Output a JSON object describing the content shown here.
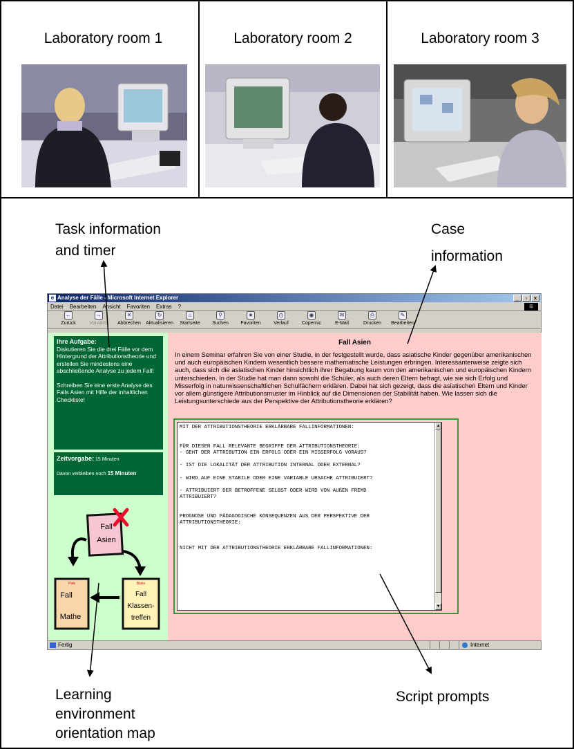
{
  "rooms": [
    {
      "label": "Laboratory room 1"
    },
    {
      "label": "Laboratory room 2"
    },
    {
      "label": "Laboratory room 3"
    }
  ],
  "callouts": {
    "task_info": [
      "Task information",
      "and timer"
    ],
    "case_info": [
      "Case",
      "information"
    ],
    "orientation_map": [
      "Learning",
      "environment",
      "orientation map"
    ],
    "script_prompts": "Script prompts"
  },
  "browser": {
    "title": "Analyse der Fälle - Microsoft Internet Explorer",
    "menu": [
      "Datei",
      "Bearbeiten",
      "Ansicht",
      "Favoriten",
      "Extras",
      "?"
    ],
    "toolbar": [
      "Zurück",
      "Vorwärts",
      "Abbrechen",
      "Aktualisieren",
      "Startseite",
      "Suchen",
      "Favoriten",
      "Verlauf",
      "Copernic",
      "E-Mail",
      "Drucken",
      "Bearbeiten"
    ],
    "status": "Fertig",
    "zone": "Internet"
  },
  "task": {
    "heading": "Ihre Aufgabe:",
    "text1": "Diskutieren Sie die drei Fälle vor dem Hintergrund der Attributionstheorie und erstellen Sie mindestens eine abschließende Analyse zu jedem Fall!",
    "text2": "Schreiben Sie eine erste Analyse des Falls Asien mit Hilfe der inhaltlichen Checkliste!"
  },
  "timer": {
    "label": "Zeitvorgabe:",
    "limit": "15 Minuten",
    "remaining_prefix": "Davon verbleiben noch",
    "remaining": "15 Minuten"
  },
  "map": {
    "asien": [
      "Fall",
      "Asien"
    ],
    "mathe": {
      "tag": "Pink",
      "lines": [
        "Fall",
        "Mathe"
      ]
    },
    "klassen": {
      "tag": "Blake",
      "lines": [
        "Fall",
        "Klassen-",
        "treffen"
      ]
    }
  },
  "case": {
    "title": "Fall Asien",
    "text": "In einem Seminar erfahren Sie von einer Studie, in der festgestellt wurde, dass asiatische Kinder gegenüber amerikanischen und auch europäischen Kindern wesentlich bessere mathematische Leistungen erbringen. Interessanterweise zeigte sich auch, dass sich die asiatischen Kinder hinsichtlich ihrer Begabung kaum von den amerikanischen und europäischen Kindern unterschieden. In der Studie hat man dann sowohl die Schüler, als auch deren Eltern befragt, wie sie sich Erfolg und Misserfolg in naturwissenschaftlichen Schulfächern erklären. Dabei hat sich gezeigt, dass die asiatischen Eltern und Kinder vor allem günstigere Attributionsmuster im Hinblick auf die Dimensionen der Stabilität haben. Wie lassen sich die Leistungsunterschiede aus der Perspektive der Attributionstheorie erklären?"
  },
  "script": {
    "lines": [
      "MIT DER ATTRIBUTIONSTHEORIE ERKLÄRBARE FALLINFORMATIONEN:",
      "",
      "",
      "FÜR DIESEN FALL RELEVANTE BEGRIFFE DER ATTRIBUTIONSTHEORIE:",
      "- GEHT DER ATTRIBUTION EIN ERFOLG ODER EIN MISSERFOLG VORAUS?",
      "",
      "- IST DIE LOKALITÄT DER ATTRIBUTION INTERNAL ODER EXTERNAL?",
      "",
      "- WIRD AUF EINE STABILE ODER EINE VARIABLE URSACHE ATTRIBUIERT?",
      "",
      "- ATTRIBUIERT DER BETROFFENE SELBST ODER WIRD VON AUßEN FREMD",
      "ATTRIBUIERT?",
      "",
      "",
      "PROGNOSE UND PÄDAGOGISCHE KONSEQUENZEN AUS DER PERSPEKTIVE DER",
      "ATTRIBUTIONSTHEORIE:",
      "",
      "",
      "",
      "NICHT MIT DER ATTRIBUTIONSTHEORIE ERKLÄRBARE FALLINFORMATIONEN:"
    ]
  },
  "colors": {
    "task_green": "#006633",
    "left_pane": "#ccffcc",
    "right_pane": "#ffcccc",
    "script_border": "#339933"
  }
}
